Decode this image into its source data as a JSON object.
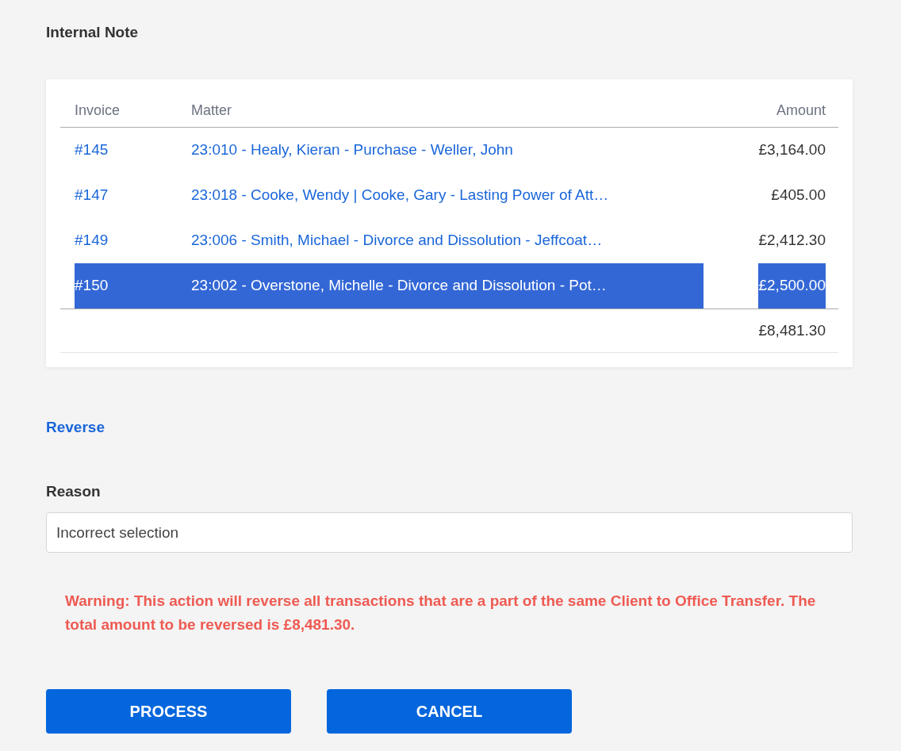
{
  "section_title": "Internal Note",
  "table": {
    "columns": [
      "Invoice",
      "Matter",
      "Amount"
    ],
    "rows": [
      {
        "invoice": "#145",
        "matter": "23:010 - Healy, Kieran - Purchase - Weller, John",
        "amount": "£3,164.00",
        "selected": false
      },
      {
        "invoice": "#147",
        "matter": "23:018 - Cooke, Wendy | Cooke, Gary - Lasting Power of Att…",
        "amount": "£405.00",
        "selected": false
      },
      {
        "invoice": "#149",
        "matter": "23:006 - Smith, Michael - Divorce and Dissolution - Jeffcoat…",
        "amount": "£2,412.30",
        "selected": false
      },
      {
        "invoice": "#150",
        "matter": "23:002 - Overstone, Michelle - Divorce and Dissolution - Pot…",
        "amount": "£2,500.00",
        "selected": true
      }
    ],
    "total": "£8,481.30"
  },
  "reverse_link": "Reverse",
  "reason": {
    "label": "Reason",
    "value": "Incorrect selection"
  },
  "warning": "Warning: This action will reverse all transactions that are a part of the same Client to Office Transfer. The total amount to be reversed is £8,481.30.",
  "buttons": [
    "PROCESS",
    "CANCEL"
  ]
}
